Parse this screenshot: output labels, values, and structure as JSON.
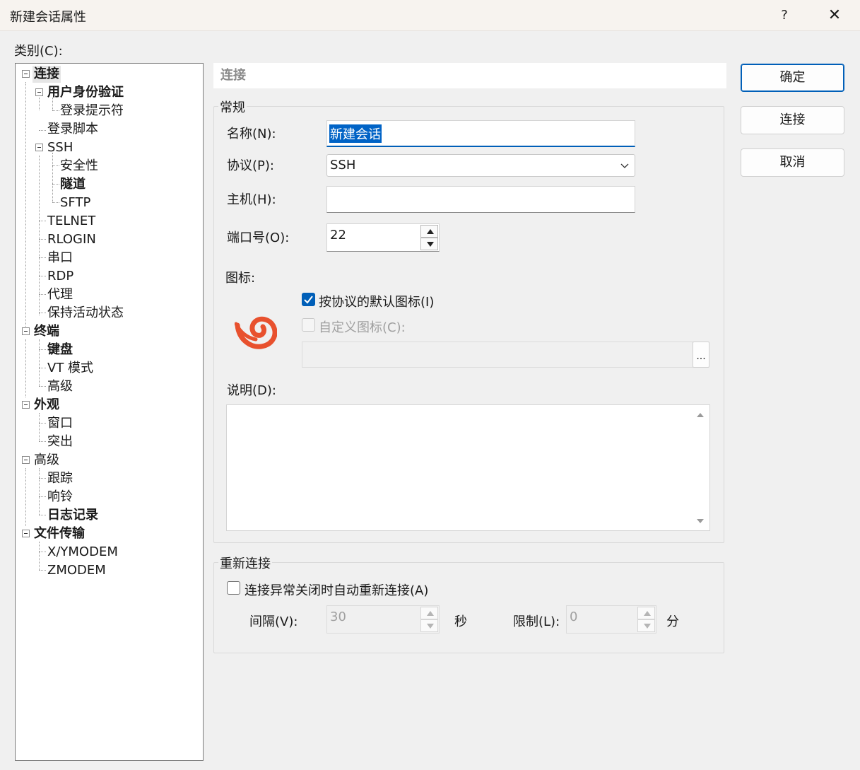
{
  "window": {
    "title": "新建会话属性",
    "help": "?",
    "close": "✕"
  },
  "category_label": "类别(C):",
  "tree": [
    {
      "label": "连接",
      "bold": true,
      "selected": true
    },
    {
      "label": "用户身份验证",
      "bold": true
    },
    {
      "label": "登录提示符"
    },
    {
      "label": "登录脚本"
    },
    {
      "label": "SSH"
    },
    {
      "label": "安全性"
    },
    {
      "label": "隧道",
      "bold": true
    },
    {
      "label": "SFTP"
    },
    {
      "label": "TELNET"
    },
    {
      "label": "RLOGIN"
    },
    {
      "label": "串口"
    },
    {
      "label": "RDP"
    },
    {
      "label": "代理"
    },
    {
      "label": "保持活动状态"
    },
    {
      "label": "终端",
      "bold": true
    },
    {
      "label": "键盘",
      "bold": true
    },
    {
      "label": "VT 模式"
    },
    {
      "label": "高级"
    },
    {
      "label": "外观",
      "bold": true
    },
    {
      "label": "窗口"
    },
    {
      "label": "突出"
    },
    {
      "label": "高级"
    },
    {
      "label": "跟踪"
    },
    {
      "label": "响铃"
    },
    {
      "label": "日志记录",
      "bold": true
    },
    {
      "label": "文件传输",
      "bold": true
    },
    {
      "label": "X/YMODEM"
    },
    {
      "label": "ZMODEM"
    }
  ],
  "section_header": "连接",
  "general": {
    "group_title": "常规",
    "name_label": "名称(N):",
    "name_value": "新建会话",
    "protocol_label": "协议(P):",
    "protocol_value": "SSH",
    "host_label": "主机(H):",
    "host_value": "",
    "port_label": "端口号(O):",
    "port_value": "22",
    "icon_label": "图标:",
    "default_icon_label": "按协议的默认图标(I)",
    "default_icon_checked": true,
    "custom_icon_label": "自定义图标(C):",
    "custom_icon_checked": false,
    "browse_label": "...",
    "desc_label": "说明(D):",
    "desc_value": ""
  },
  "reconnect": {
    "group_title": "重新连接",
    "auto_label": "连接异常关闭时自动重新连接(A)",
    "auto_checked": false,
    "interval_label": "间隔(V):",
    "interval_value": "30",
    "seconds_unit": "秒",
    "limit_label": "限制(L):",
    "limit_value": "0",
    "minutes_unit": "分"
  },
  "buttons": {
    "ok": "确定",
    "connect": "连接",
    "cancel": "取消"
  },
  "colors": {
    "accent": "#005fb8",
    "icon": "#e8512e"
  }
}
